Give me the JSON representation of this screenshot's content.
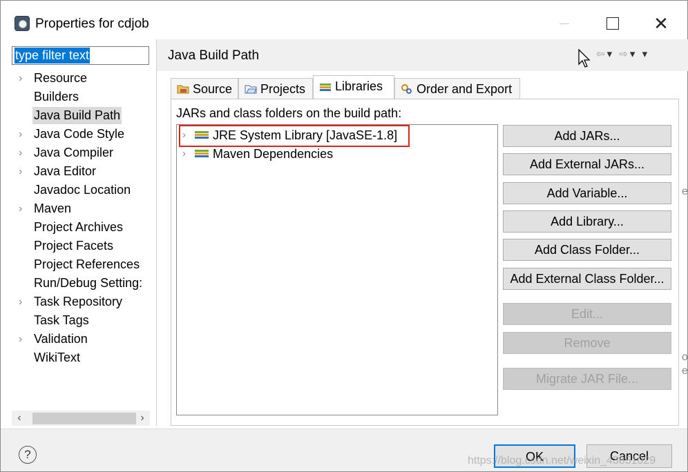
{
  "window": {
    "title": "Properties for cdjob"
  },
  "filter": {
    "value": "type filter text"
  },
  "tree": {
    "items": [
      {
        "label": "Resource",
        "expandable": true
      },
      {
        "label": "Builders",
        "expandable": false
      },
      {
        "label": "Java Build Path",
        "expandable": false,
        "selected": true
      },
      {
        "label": "Java Code Style",
        "expandable": true
      },
      {
        "label": "Java Compiler",
        "expandable": true
      },
      {
        "label": "Java Editor",
        "expandable": true
      },
      {
        "label": "Javadoc Location",
        "expandable": false
      },
      {
        "label": "Maven",
        "expandable": true
      },
      {
        "label": "Project Archives",
        "expandable": false
      },
      {
        "label": "Project Facets",
        "expandable": false
      },
      {
        "label": "Project References",
        "expandable": false
      },
      {
        "label": "Run/Debug Setting:",
        "expandable": false
      },
      {
        "label": "Task Repository",
        "expandable": true
      },
      {
        "label": "Task Tags",
        "expandable": false
      },
      {
        "label": "Validation",
        "expandable": true
      },
      {
        "label": "WikiText",
        "expandable": false
      }
    ]
  },
  "page": {
    "title": "Java Build Path"
  },
  "tabs": [
    {
      "label": "Source",
      "icon": "source-folder-icon"
    },
    {
      "label": "Projects",
      "icon": "projects-folder-icon"
    },
    {
      "label": "Libraries",
      "icon": "libraries-icon",
      "active": true
    },
    {
      "label": "Order and Export",
      "icon": "order-export-icon"
    }
  ],
  "libraries": {
    "label": "JARs and class folders on the build path:",
    "entries": [
      {
        "label": "JRE System Library [JavaSE-1.8]",
        "highlighted": true
      },
      {
        "label": "Maven Dependencies",
        "highlighted": false
      }
    ]
  },
  "buttons": {
    "add_jars": "Add JARs...",
    "add_external_jars": "Add External JARs...",
    "add_variable": "Add Variable...",
    "add_library": "Add Library...",
    "add_class_folder": "Add Class Folder...",
    "add_external_class_folder": "Add External Class Folder...",
    "edit": "Edit...",
    "remove": "Remove",
    "migrate_jar": "Migrate JAR File..."
  },
  "footer": {
    "help": "?",
    "ok": "OK",
    "cancel": "Cancel"
  },
  "watermark": "https://blog.csdn.net/weixin_43851029",
  "colors": {
    "selection": "#0078d7",
    "highlight_border": "#e0201c"
  }
}
